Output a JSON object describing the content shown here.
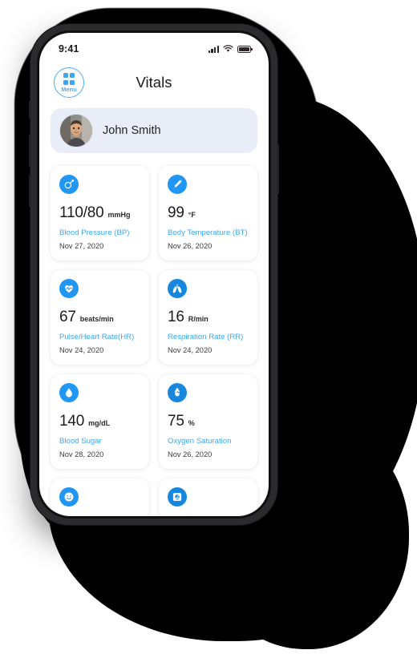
{
  "statusbar": {
    "time": "9:41",
    "signal_icon": "cellular-signal-icon",
    "wifi_icon": "wifi-icon",
    "battery_icon": "battery-icon"
  },
  "header": {
    "menu_label": "Menu",
    "menu_icon": "grid-menu-icon",
    "title": "Vitals"
  },
  "patient": {
    "name": "John Smith",
    "avatar_icon": "user-avatar-photo"
  },
  "colors": {
    "accent_blue": "#3FA7F0",
    "icon_blue": "#2196F3",
    "icon_blue_deep": "#1787DE",
    "patient_card_bg": "#E8EDF7",
    "text_dark": "#1d1d1f",
    "date_gray": "#3b3b3d"
  },
  "vitals": [
    {
      "icon": "blood-pressure-cuff-icon",
      "icon_bg": "#2196F3",
      "value": "110/80",
      "unit": "mmHg",
      "label": "Blood Pressure (BP)",
      "date": "Nov 27, 2020"
    },
    {
      "icon": "thermometer-icon",
      "icon_bg": "#2196F3",
      "value": "99",
      "unit": "°F",
      "label": "Body Temperature (BT)",
      "date": "Nov 26, 2020"
    },
    {
      "icon": "heart-pulse-icon",
      "icon_bg": "#2196F3",
      "value": "67",
      "unit": "beats/min",
      "label": "Pulse/Heart Rate(HR)",
      "date": "Nov 24, 2020"
    },
    {
      "icon": "lungs-icon",
      "icon_bg": "#1787DE",
      "value": "16",
      "unit": "R/min",
      "label": "Respiration Rate (RR)",
      "date": "Nov 24, 2020"
    },
    {
      "icon": "water-drop-icon",
      "icon_bg": "#2196F3",
      "value": "140",
      "unit": "mg/dL",
      "label": "Blood Sugar",
      "date": "Nov 28, 2020"
    },
    {
      "icon": "pulse-oximeter-icon",
      "icon_bg": "#1787DE",
      "value": "75",
      "unit": "%",
      "label": "Oxygen Saturation",
      "date": "Nov 26, 2020"
    }
  ],
  "partial_vitals": [
    {
      "icon": "smiley-face-pain-scale-icon",
      "icon_bg": "#2196F3"
    },
    {
      "icon": "body-weight-scale-icon",
      "icon_bg": "#1787DE"
    }
  ]
}
